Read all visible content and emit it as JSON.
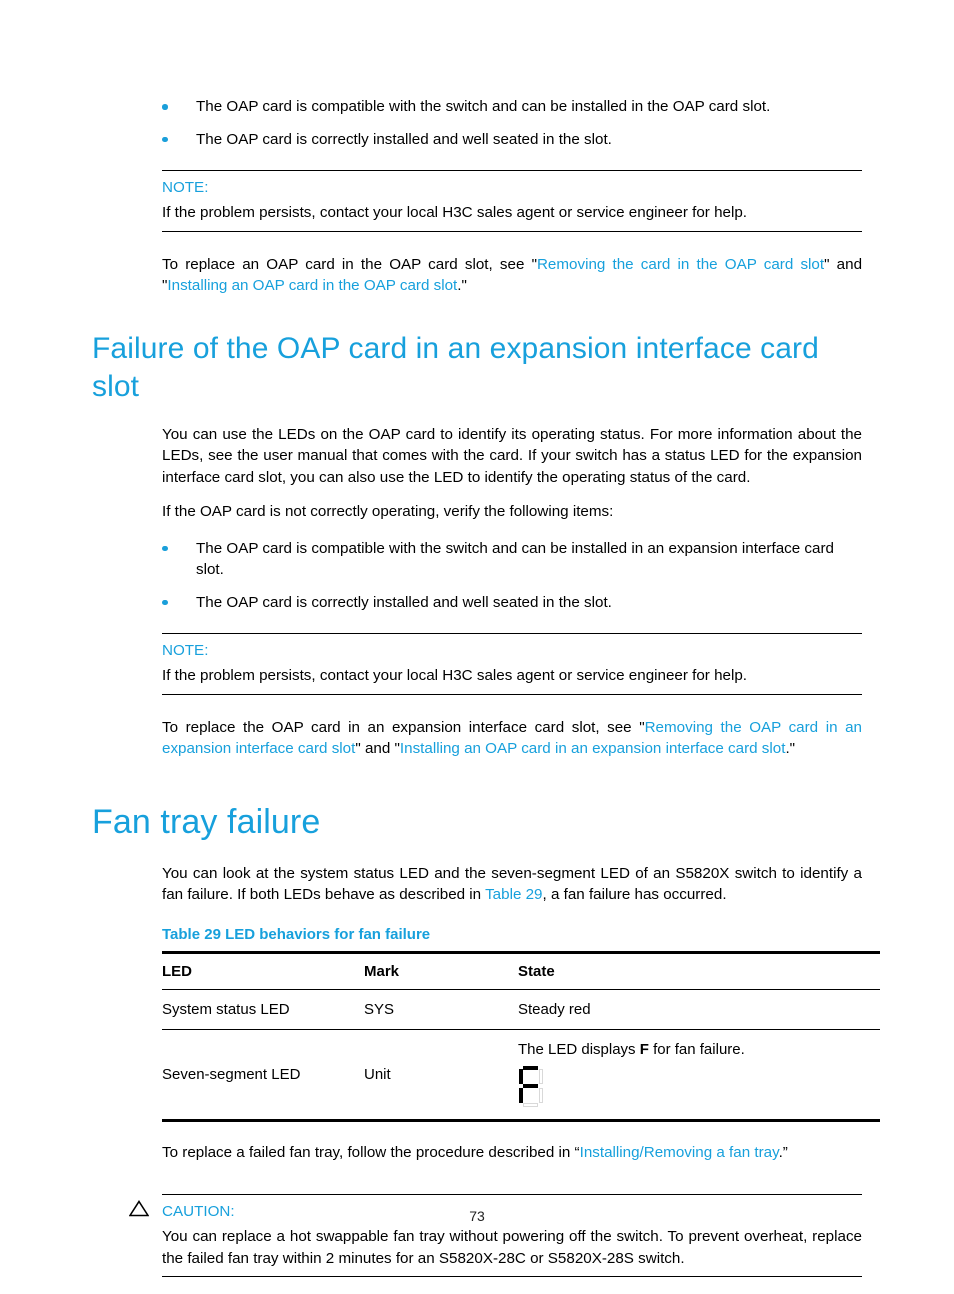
{
  "page": {
    "number": "73",
    "accent_color": "#17a0dc",
    "text_color": "#000000"
  },
  "top_checklist": {
    "items": [
      "The OAP card is compatible with the switch and can be installed in the OAP card slot.",
      "The OAP card is correctly installed and well seated in the slot."
    ]
  },
  "note_one": {
    "label": "NOTE:",
    "text": "If the problem persists, contact your local H3C sales agent or service engineer for help."
  },
  "replace_oap_slot": {
    "lead": "To replace an OAP card in the OAP card slot, see \"",
    "link_one": "Removing the card in the OAP card slot",
    "mid": "\" and \"",
    "link_two": "Installing an OAP card in the OAP card slot",
    "tail": ".\""
  },
  "section_expansion": {
    "heading": "Failure of the OAP card in an expansion interface card slot",
    "paragraph_one": "You can use the LEDs on the OAP card to identify its operating status. For more information about the LEDs, see the user manual that comes with the card. If your switch has a status LED for the expansion interface card slot, you can also use the LED to identify the operating status of the card.",
    "paragraph_two": "If the OAP card is not correctly operating, verify the following items:",
    "checklist": [
      "The OAP card is compatible with the switch and can be installed in an expansion interface card slot.",
      "The OAP card is correctly installed and well seated in the slot."
    ],
    "note": {
      "label": "NOTE:",
      "text": "If the problem persists, contact your local H3C sales agent or service engineer for help."
    },
    "replace": {
      "lead": "To replace the OAP card in an expansion interface card slot, see \"",
      "link_one": "Removing the OAP card in an expansion interface card slot",
      "mid": "\" and \"",
      "link_two": "Installing an OAP card in an expansion interface card slot",
      "tail": ".\""
    }
  },
  "section_fan": {
    "heading": "Fan tray failure",
    "intro_lead": "You can look at the system status LED and the seven-segment LED of an S5820X switch to identify a fan failure. If both LEDs behave as described in ",
    "intro_link": "Table 29",
    "intro_tail": ", a fan failure has occurred.",
    "table_caption": "Table 29 LED behaviors for fan failure",
    "table": {
      "columns": [
        "LED",
        "Mark",
        "State"
      ],
      "rows": [
        {
          "led": "System status LED",
          "mark": "SYS",
          "state": "Steady red",
          "has_seven_segment": false
        },
        {
          "led": "Seven-segment LED",
          "mark": "Unit",
          "state_prefix": "The LED displays ",
          "state_bold": "F",
          "state_suffix": " for fan failure.",
          "has_seven_segment": true,
          "seven_segment": {
            "character": "F",
            "segments_on": [
              "a",
              "f",
              "g",
              "e"
            ],
            "segments_off": [
              "b",
              "c",
              "d"
            ]
          }
        }
      ]
    },
    "replace_lead": "To replace a failed fan tray, follow the procedure described in “",
    "replace_link": "Installing/Removing a fan tray",
    "replace_tail": ".”",
    "caution": {
      "icon": "warning-triangle-icon",
      "label": "CAUTION:",
      "text": "You can replace a hot swappable fan tray without powering off the switch. To prevent overheat, replace the failed fan tray within 2 minutes for an S5820X-28C or S5820X-28S switch."
    }
  }
}
